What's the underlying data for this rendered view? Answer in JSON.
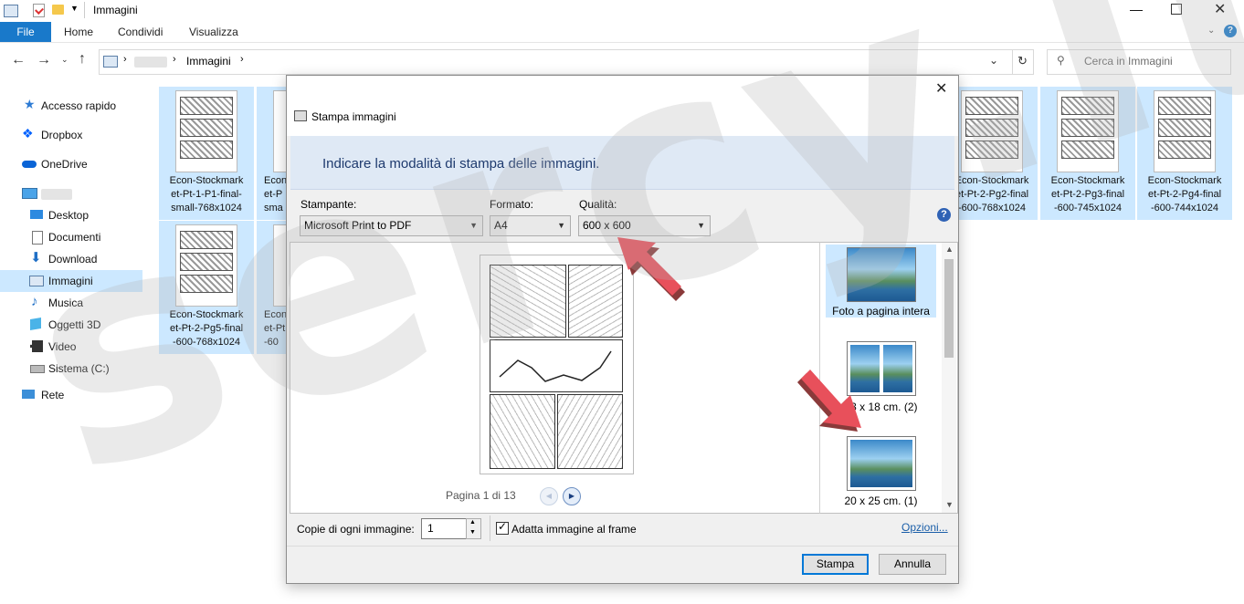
{
  "window": {
    "title": "Immagini",
    "tabs": [
      "File",
      "Home",
      "Condividi",
      "Visualizza"
    ]
  },
  "address": {
    "path": [
      "Immagini"
    ],
    "search_placeholder": "Cerca in Immagini"
  },
  "nav": {
    "items": [
      {
        "label": "Accesso rapido",
        "icon": "star-icon"
      },
      {
        "label": "Dropbox",
        "icon": "dropbox-icon"
      },
      {
        "label": "OneDrive",
        "icon": "cloud-icon"
      },
      {
        "label": "Desktop",
        "icon": "desktop-icon"
      },
      {
        "label": "Documenti",
        "icon": "document-icon"
      },
      {
        "label": "Download",
        "icon": "download-icon"
      },
      {
        "label": "Immagini",
        "icon": "pictures-icon"
      },
      {
        "label": "Musica",
        "icon": "music-icon"
      },
      {
        "label": "Oggetti 3D",
        "icon": "cube-icon"
      },
      {
        "label": "Video",
        "icon": "video-icon"
      },
      {
        "label": "Sistema (C:)",
        "icon": "drive-icon"
      },
      {
        "label": "Rete",
        "icon": "network-icon"
      }
    ]
  },
  "files": [
    {
      "l1": "Econ-Stockmark",
      "l2": "et-Pt-1-P1-final-",
      "l3": "small-768x1024"
    },
    {
      "l1": "Econ",
      "l2": "et-P",
      "l3": "sma"
    },
    {
      "l1": "Econ-Stockmark",
      "l2": "et-Pt-2-Pg2-final",
      "l3": "-600-768x1024"
    },
    {
      "l1": "Econ-Stockmark",
      "l2": "et-Pt-2-Pg3-final",
      "l3": "-600-745x1024"
    },
    {
      "l1": "Econ-Stockmark",
      "l2": "et-Pt-2-Pg4-final",
      "l3": "-600-744x1024"
    },
    {
      "l1": "Econ-Stockmark",
      "l2": "et-Pt-2-Pg5-final",
      "l3": "-600-768x1024"
    },
    {
      "l1": "Econ",
      "l2": "et-Pt",
      "l3": "-60"
    }
  ],
  "dialog": {
    "title": "Stampa immagini",
    "heading": "Indicare la modalità di stampa delle immagini.",
    "printer_label": "Stampante:",
    "printer_value": "Microsoft Print to PDF",
    "format_label": "Formato:",
    "format_value": "A4",
    "quality_label": "Qualità:",
    "quality_value": "600 x 600",
    "page_info": "Pagina 1 di 13",
    "layouts": [
      {
        "label": "Foto a pagina intera"
      },
      {
        "label": "13 x 18 cm. (2)"
      },
      {
        "label": "20 x 25 cm. (1)"
      }
    ],
    "copies_label": "Copie di ogni immagine:",
    "copies_value": "1",
    "fit_label": "Adatta immagine al frame",
    "fit_checked": true,
    "options_link": "Opzioni...",
    "print_button": "Stampa",
    "cancel_button": "Annulla"
  },
  "watermark": "sercy.it",
  "colors": {
    "accent": "#1979ca",
    "banner": "#dfe9f5",
    "arrow": "#e8505b"
  }
}
